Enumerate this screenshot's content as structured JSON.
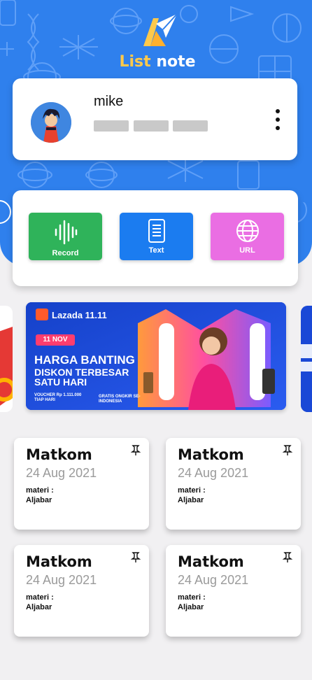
{
  "app": {
    "title_part1": "List",
    "title_part2": "note"
  },
  "profile": {
    "name": "mike"
  },
  "actions": [
    {
      "label": "Record",
      "color": "#2fb35a",
      "icon": "soundwave-icon"
    },
    {
      "label": "Text",
      "color": "#1b7cf0",
      "icon": "document-icon"
    },
    {
      "label": "URL",
      "color": "#ea6ee3",
      "icon": "globe-icon"
    }
  ],
  "banner": {
    "brand": "Lazada 11.11",
    "date": "11 NOV",
    "headline1": "HARGA BANTING",
    "headline2": "DISKON TERBESAR",
    "headline3": "SATU HARI",
    "voucher": "VOUCHER Rp 1.111.000 TIAP HARI",
    "shipping": "GRATIS ONGKIR SE-INDONESIA"
  },
  "notes": [
    {
      "title": "Matkom",
      "date": "24 Aug 2021",
      "line1": "materi :",
      "line2": "Aljabar"
    },
    {
      "title": "Matkom",
      "date": "24 Aug 2021",
      "line1": "materi :",
      "line2": "Aljabar"
    },
    {
      "title": "Matkom",
      "date": "24 Aug 2021",
      "line1": "materi :",
      "line2": "Aljabar"
    },
    {
      "title": "Matkom",
      "date": "24 Aug 2021",
      "line1": "materi :",
      "line2": "Aljabar"
    }
  ]
}
